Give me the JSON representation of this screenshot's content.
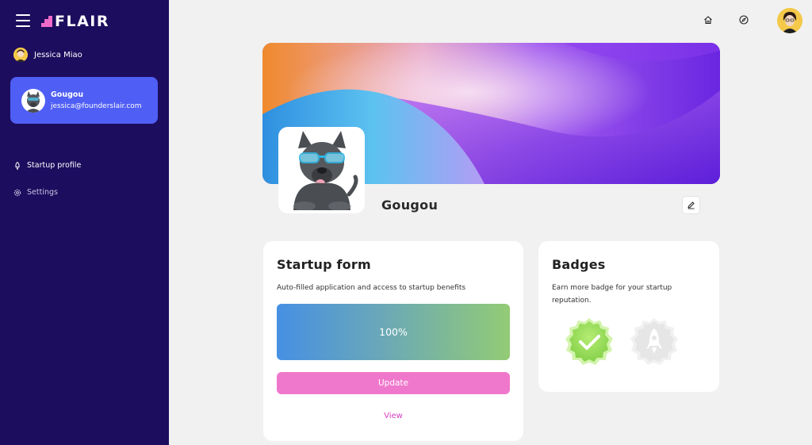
{
  "sidebar": {
    "logo_text": "FLAIR",
    "user_name": "Jessica Miao",
    "startup": {
      "name": "Gougou",
      "email": "jessica@founderslair.com"
    },
    "nav": [
      {
        "label": "Startup profile",
        "icon": "rocket-icon"
      },
      {
        "label": "Settings",
        "icon": "gear-icon"
      }
    ]
  },
  "topbar": {
    "icons": [
      "home-icon",
      "compass-icon",
      "user-avatar"
    ]
  },
  "profile": {
    "name": "Gougou"
  },
  "startup_form": {
    "title": "Startup form",
    "description": "Auto-filled application and access to startup benefits",
    "progress": 1.0,
    "progress_label": "100%",
    "update_label": "Update",
    "view_label": "View"
  },
  "badges": {
    "title": "Badges",
    "description_line1": "Earn more badge for your startup",
    "description_line2": "reputation.",
    "items": [
      {
        "name": "checkmark-badge",
        "earned": true
      },
      {
        "name": "rocket-badge",
        "earned": false
      }
    ]
  },
  "colors": {
    "sidebar_bg": "#1d0d5e",
    "active_card": "#4f5ef5",
    "accent_pink": "#f078cc",
    "link_pink": "#d640c4"
  }
}
